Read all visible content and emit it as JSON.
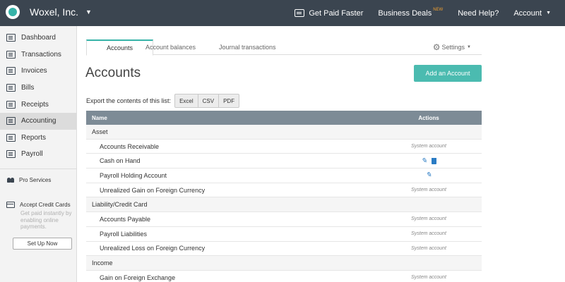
{
  "brand": {
    "name": "Woxel, Inc."
  },
  "topnav": {
    "get_paid": "Get Paid Faster",
    "deals": "Business Deals",
    "deals_badge": "NEW",
    "help": "Need Help?",
    "account": "Account"
  },
  "sidebar": {
    "items": [
      {
        "label": "Dashboard"
      },
      {
        "label": "Transactions"
      },
      {
        "label": "Invoices"
      },
      {
        "label": "Bills"
      },
      {
        "label": "Receipts"
      },
      {
        "label": "Accounting"
      },
      {
        "label": "Reports"
      },
      {
        "label": "Payroll"
      }
    ],
    "pro_services": "Pro Services",
    "accept_title": "Accept Credit Cards",
    "accept_desc": "Get paid instantly by enabling online payments.",
    "setup_label": "Set Up Now"
  },
  "tabs": [
    {
      "label": "Accounts"
    },
    {
      "label": "Account balances"
    },
    {
      "label": "Journal transactions"
    }
  ],
  "settings_label": "Settings",
  "page_title": "Accounts",
  "add_button": "Add an Account",
  "export": {
    "label": "Export the contents of this list:",
    "buttons": [
      "Excel",
      "CSV",
      "PDF"
    ]
  },
  "table": {
    "col_name": "Name",
    "col_actions": "Actions",
    "system_label": "System account",
    "rows": [
      {
        "name": "Asset"
      },
      {
        "name": "Accounts Receivable"
      },
      {
        "name": "Cash on Hand"
      },
      {
        "name": "Payroll Holding Account"
      },
      {
        "name": "Unrealized Gain on Foreign Currency"
      },
      {
        "name": "Liability/Credit Card"
      },
      {
        "name": "Accounts Payable"
      },
      {
        "name": "Payroll Liabilities"
      },
      {
        "name": "Unrealized Loss on Foreign Currency"
      },
      {
        "name": "Income"
      },
      {
        "name": "Gain on Foreign Exchange"
      }
    ]
  },
  "colors": {
    "topbar": "#3b4550",
    "accent": "#36b3a8",
    "add_button": "#4bbbb0",
    "table_header": "#7d8b96",
    "action_icon": "#2b7cc4"
  }
}
